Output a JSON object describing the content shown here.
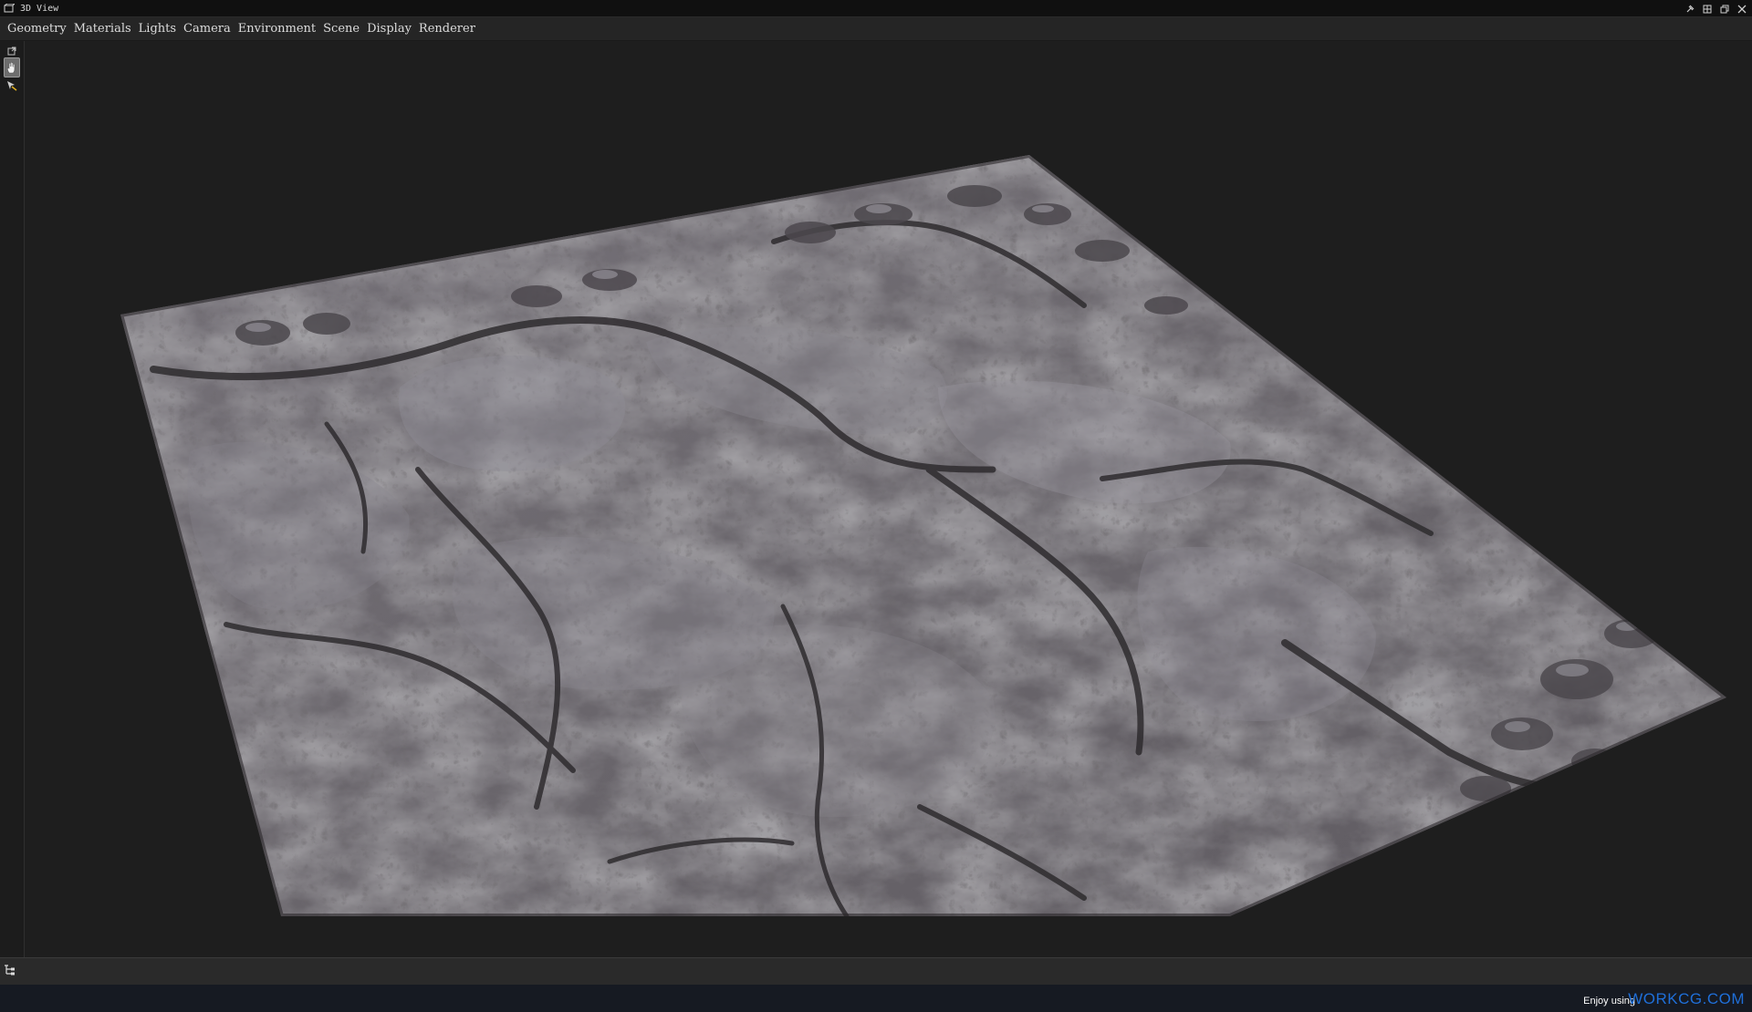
{
  "window": {
    "title": "3D View"
  },
  "menu": {
    "items": [
      "Geometry",
      "Materials",
      "Lights",
      "Camera",
      "Environment",
      "Scene",
      "Display",
      "Renderer"
    ]
  },
  "toolbar": {
    "tools": [
      {
        "icon": "expand-icon"
      },
      {
        "icon": "hand-pan-icon",
        "active": true
      },
      {
        "icon": "pick-arrow-icon"
      }
    ]
  },
  "status": {
    "icon": "tree-hierarchy-icon"
  },
  "footer": {
    "enjoy_text": "Enjoy using",
    "brand_text": "WORKCG.COM",
    "brand_color": "#1f6fd9"
  },
  "colors": {
    "background": "#1e1e1e",
    "rock_base": "#6f6c70",
    "rock_highlight": "#a9a6ad",
    "rock_shadow": "#2e2b2e"
  }
}
